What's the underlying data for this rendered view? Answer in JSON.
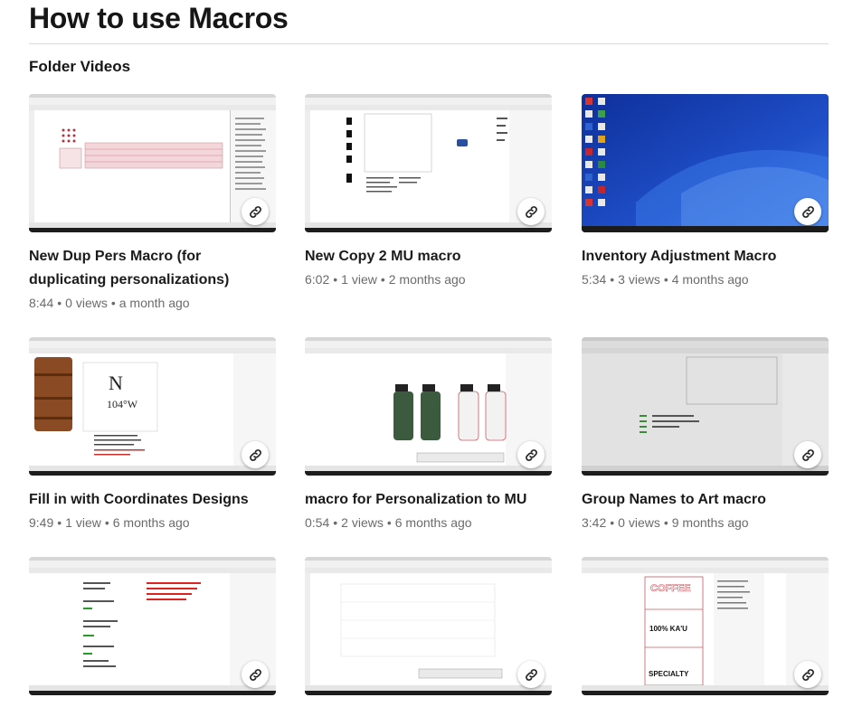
{
  "page": {
    "title": "How to use Macros",
    "section": "Folder Videos"
  },
  "videos": [
    {
      "title": "New Dup Pers Macro (for duplicating personalizations)",
      "duration": "8:44",
      "views": "0 views",
      "age": "a month ago"
    },
    {
      "title": "New Copy 2 MU macro",
      "duration": "6:02",
      "views": "1 view",
      "age": "2 months ago"
    },
    {
      "title": "Inventory Adjustment Macro",
      "duration": "5:34",
      "views": "3 views",
      "age": "4 months ago"
    },
    {
      "title": "Fill in with Coordinates Designs",
      "duration": "9:49",
      "views": "1 view",
      "age": "6 months ago"
    },
    {
      "title": "macro for Personalization to MU",
      "duration": "0:54",
      "views": "2 views",
      "age": "6 months ago"
    },
    {
      "title": "Group Names to Art macro",
      "duration": "3:42",
      "views": "0 views",
      "age": "9 months ago"
    },
    {
      "title": "",
      "duration": "",
      "views": "",
      "age": ""
    },
    {
      "title": "",
      "duration": "",
      "views": "",
      "age": ""
    },
    {
      "title": "",
      "duration": "",
      "views": "",
      "age": ""
    }
  ],
  "thumb_text": {
    "t4_big": "N",
    "t4_big2": "104°W",
    "t9_line1": "100% KA'U",
    "t9_line2": "SPECIALTY",
    "t9_line3": "COFFEE"
  },
  "icons": {
    "share": "link-icon"
  },
  "colors": {
    "text": "#1b1b1b",
    "meta": "#6b6b6b",
    "divider": "#d9d9d9",
    "desktop_blue": "#1f4fc8"
  }
}
